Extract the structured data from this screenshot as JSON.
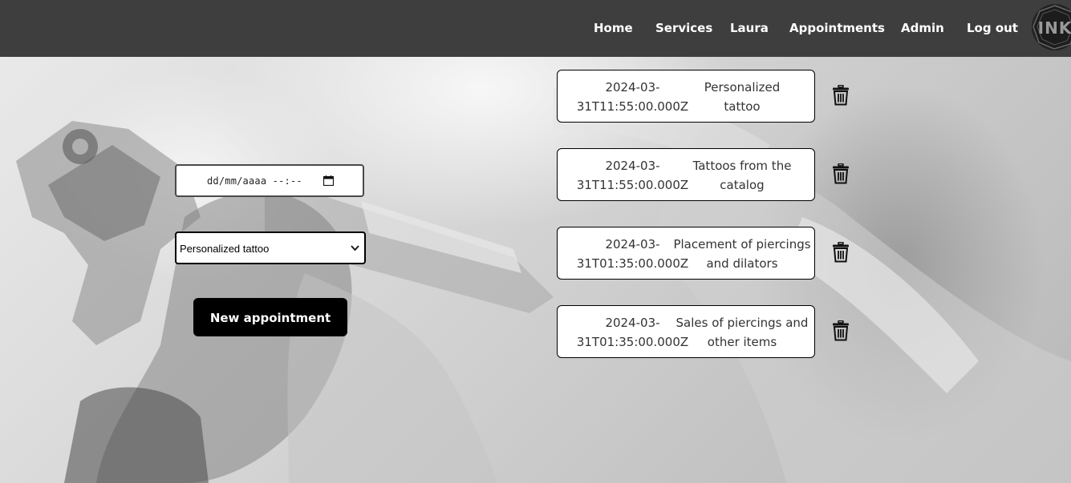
{
  "nav": {
    "links": [
      "Home",
      "Services",
      "Laura",
      "Appointments",
      "Admin",
      "Log out"
    ],
    "logo_text": "INK"
  },
  "form": {
    "date_placeholder": "dd/mm/aaaa --:--",
    "selected_service": "Personalized tattoo",
    "submit_label": "New appointment"
  },
  "appointments": [
    {
      "date_line1": "2024-03-",
      "date_line2": "31T11:55:00.000Z",
      "service_line1": "Personalized",
      "service_line2": "tattoo"
    },
    {
      "date_line1": "2024-03-",
      "date_line2": "31T11:55:00.000Z",
      "service_line1": "Tattoos from the",
      "service_line2": "catalog"
    },
    {
      "date_line1": "2024-03-",
      "date_line2": "31T01:35:00.000Z",
      "service_line1": "Placement of piercings",
      "service_line2": "and dilators"
    },
    {
      "date_line1": "2024-03-",
      "date_line2": "31T01:35:00.000Z",
      "service_line1": "Sales of piercings and",
      "service_line2": "other items"
    }
  ],
  "icons": {
    "delete": "trash-icon",
    "calendar": "calendar-icon",
    "select": "chevron-down-icon"
  },
  "colors": {
    "navbar": "#3e3e3e",
    "button": "#000000",
    "card_border": "#000000"
  }
}
